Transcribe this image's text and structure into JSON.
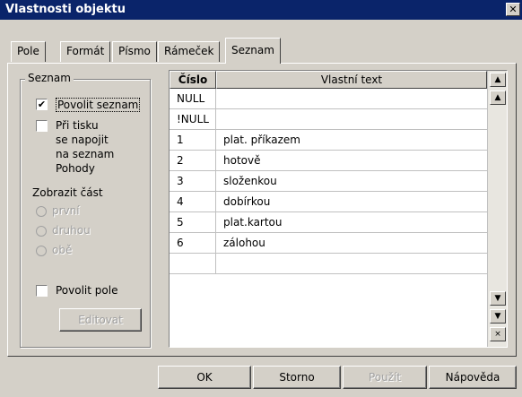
{
  "window": {
    "title": "Vlastnosti objektu",
    "close_label": "✕"
  },
  "tabs": [
    {
      "label": "Pole"
    },
    {
      "label": "Formát"
    },
    {
      "label": "Písmo"
    },
    {
      "label": "Rámeček"
    },
    {
      "label": "Seznam",
      "active": true
    }
  ],
  "group": {
    "title": "Seznam",
    "allow_list": {
      "label": "Povolit seznam",
      "checked": true
    },
    "print_link": {
      "label_lines": [
        "Při tisku",
        "se napojit",
        "na seznam",
        "Pohody"
      ],
      "checked": false
    },
    "show_part_label": "Zobrazit část",
    "radios": [
      "první",
      "druhou",
      "obě"
    ],
    "allow_field": {
      "label": "Povolit pole",
      "checked": false
    },
    "edit_button": "Editovat"
  },
  "table": {
    "columns": [
      "Číslo",
      "Vlastní text"
    ],
    "rows": [
      {
        "num": "NULL",
        "text": ""
      },
      {
        "num": "!NULL",
        "text": ""
      },
      {
        "num": "1",
        "text": "plat. příkazem"
      },
      {
        "num": "2",
        "text": "hotově"
      },
      {
        "num": "3",
        "text": "složenkou"
      },
      {
        "num": "4",
        "text": "dobírkou"
      },
      {
        "num": "5",
        "text": "plat.kartou"
      },
      {
        "num": "6",
        "text": "zálohou"
      },
      {
        "num": "",
        "text": ""
      }
    ]
  },
  "buttons": {
    "ok": "OK",
    "cancel": "Storno",
    "apply": "Použít",
    "help": "Nápověda"
  }
}
